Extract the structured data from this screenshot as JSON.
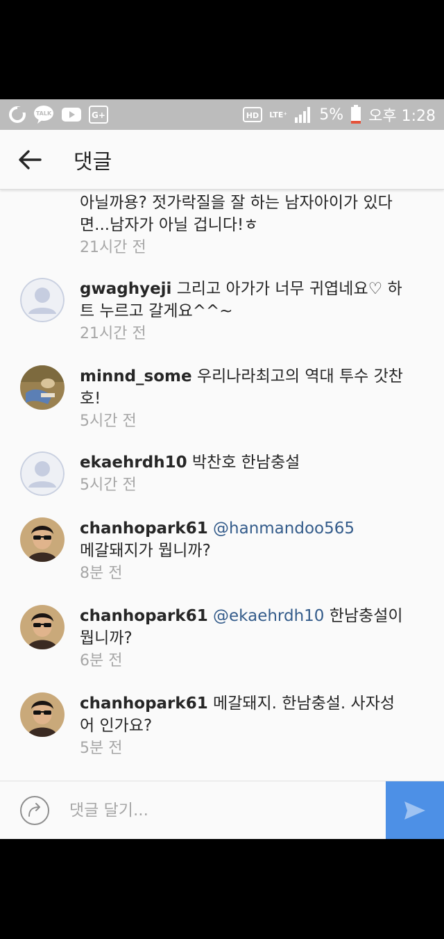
{
  "status_bar": {
    "left_icons": [
      "g-icon",
      "kakaotalk-icon",
      "youtube-icon",
      "google-plus-icon"
    ],
    "talk_label": "TALK",
    "gplus_label": "G+",
    "hd_label": "HD",
    "lte_label": "LTE⁺",
    "battery_percent": "5%",
    "time": "오후 1:28"
  },
  "header": {
    "title": "댓글"
  },
  "comments": [
    {
      "username": "",
      "text": "아닐까용? 젓가락질을 잘 하는 남자아이가 있다면...남자가 아닐 겁니다!ㅎ",
      "time": "21시간 전",
      "avatar": "none"
    },
    {
      "username": "gwaghyeji",
      "text": "그리고 아가가 너무 귀엽네요♡ 하트 누르고 갈게요^^~",
      "time": "21시간 전",
      "avatar": "default"
    },
    {
      "username": "minnd_some",
      "text": "우리나라최고의 역대 투수 갓찬호!",
      "time": "5시간 전",
      "avatar": "photo"
    },
    {
      "username": "ekaehrdh10",
      "text": "박찬호 한남충설",
      "time": "5시간 전",
      "avatar": "default"
    },
    {
      "username": "chanhopark61",
      "mention": "@hanmandoo565",
      "text": "메갈돼지가 뭡니까?",
      "time": "8분 전",
      "avatar": "profile"
    },
    {
      "username": "chanhopark61",
      "mention": "@ekaehrdh10",
      "text": "한남충설이 뭡니까?",
      "time": "6분 전",
      "avatar": "profile"
    },
    {
      "username": "chanhopark61",
      "text": "메갈돼지. 한남충설. 사자성어 인가요?",
      "time": "5분 전",
      "avatar": "profile"
    }
  ],
  "input": {
    "placeholder": "댓글 달기..."
  },
  "colors": {
    "send_button": "#4d90e6",
    "mention": "#335b8a",
    "timestamp": "#a6a6a6"
  }
}
